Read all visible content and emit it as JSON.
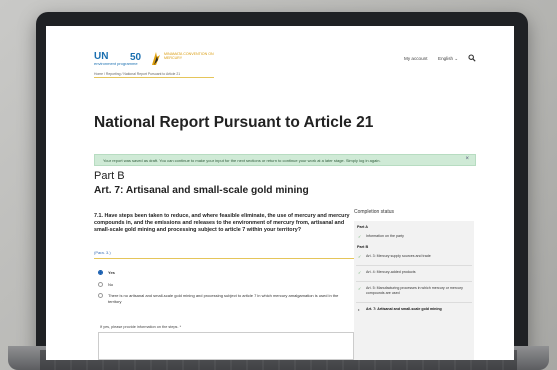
{
  "header": {
    "logo_un": "UN",
    "logo_un_sub": "environment programme",
    "logo_50": "50",
    "logo_minamata": "MINAMATA CONVENTION ON MERCURY",
    "nav_account": "My account",
    "nav_language": "English ⌄",
    "breadcrumb": "Home / Reporting / National Report Pursuant to Article 21"
  },
  "page_title": "National Report Pursuant to Article 21",
  "alert": {
    "text": "Your report was saved as draft. You can continue to make your input for the next sections or return to continue your work at a later stage. Simply log in again.",
    "close": "×"
  },
  "part": "Part B",
  "section": "Art. 7: Artisanal and small-scale gold mining",
  "question": {
    "text": "7.1. Have steps been taken to reduce, and where feasible eliminate, the use of mercury and mercury compounds in, and the emissions and releases to the environment of mercury from, artisanal and small-scale gold mining and processing subject to article 7 within your territory?",
    "ref": "(Para. 3.)"
  },
  "options": [
    {
      "label": "Yes",
      "checked": true
    },
    {
      "label": "No",
      "checked": false
    },
    {
      "label": "There is no artisanal and small-scale gold mining and processing subject to article 7 in which mercury amalgamation is used in the territory",
      "checked": false
    }
  ],
  "info_label": "If yes, please provide information on the steps. *",
  "completion": {
    "title": "Completion status",
    "part_a": "Part A",
    "part_b": "Part B",
    "items_a": [
      "Information on the party"
    ],
    "items_b": [
      "Art. 3: Mercury supply sources and trade",
      "Art. 4: Mercury-added products",
      "Art. 5: Manufacturing processes in which mercury or mercury compounds are used",
      "Art. 7: Artisanal and small-scale gold mining"
    ]
  },
  "icons": {
    "check": "✓",
    "current": "•"
  }
}
